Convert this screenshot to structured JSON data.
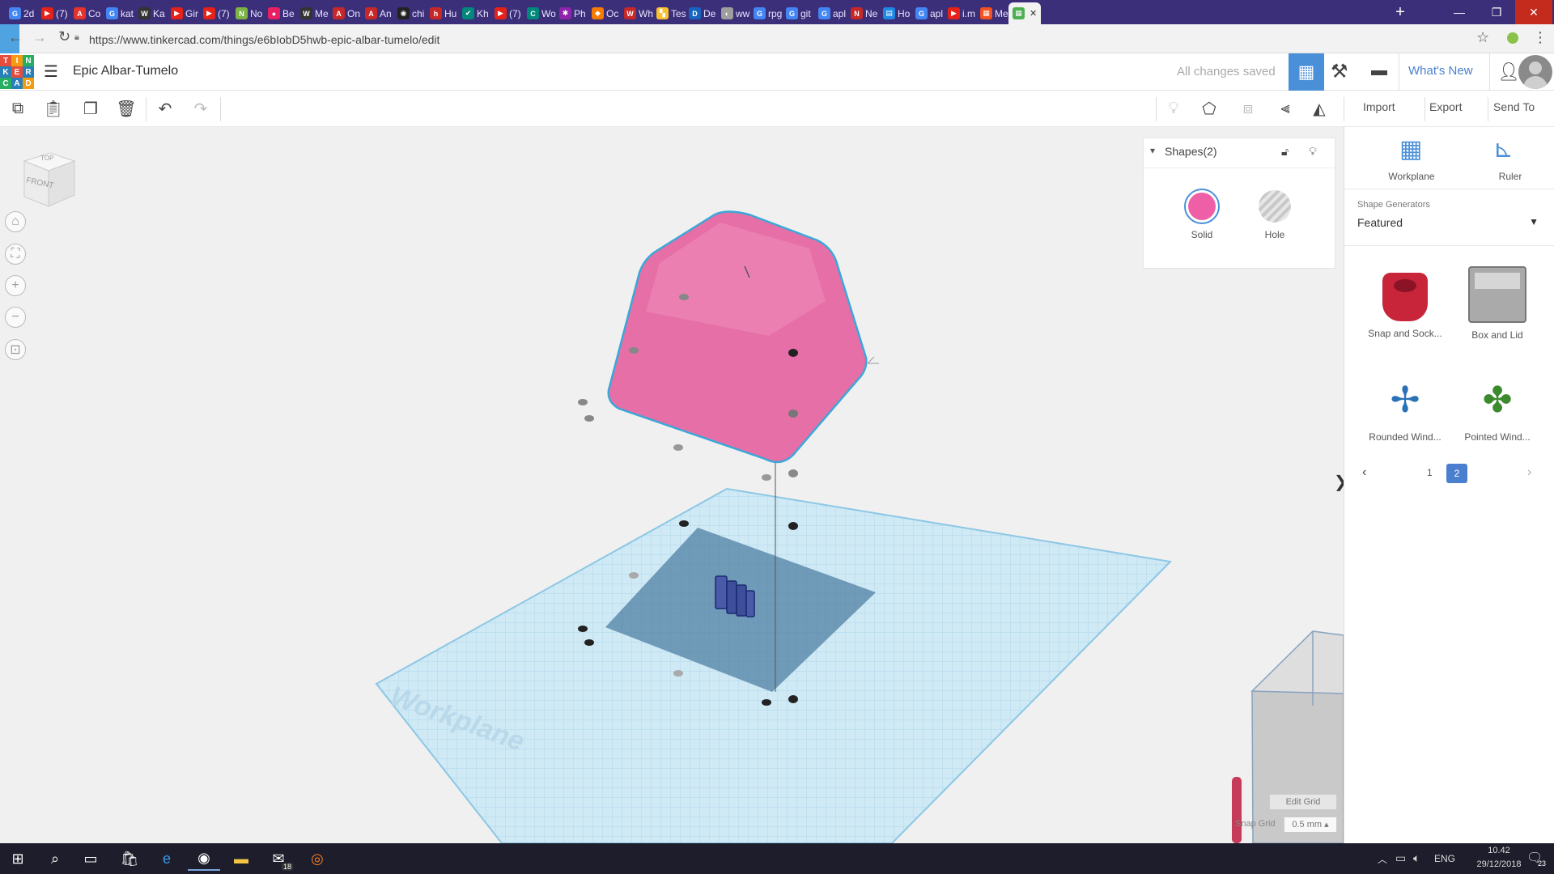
{
  "browser": {
    "tabs": [
      {
        "label": "2d",
        "color": "#4285f4",
        "glyph": "G"
      },
      {
        "label": "(7)",
        "color": "#e62117",
        "glyph": "▶"
      },
      {
        "label": "Co",
        "color": "#e5322d",
        "glyph": "A"
      },
      {
        "label": "kat",
        "color": "#4285f4",
        "glyph": "G"
      },
      {
        "label": "Ka",
        "color": "#333333",
        "glyph": "W"
      },
      {
        "label": "Gir",
        "color": "#e62117",
        "glyph": "▶"
      },
      {
        "label": "(7)",
        "color": "#e62117",
        "glyph": "▶"
      },
      {
        "label": "No",
        "color": "#7cb342",
        "glyph": "N"
      },
      {
        "label": "Be",
        "color": "#e91e63",
        "glyph": "●"
      },
      {
        "label": "Me",
        "color": "#333333",
        "glyph": "W"
      },
      {
        "label": "On",
        "color": "#c62828",
        "glyph": "A"
      },
      {
        "label": "An",
        "color": "#c62828",
        "glyph": "A"
      },
      {
        "label": "chi",
        "color": "#222222",
        "glyph": "◉"
      },
      {
        "label": "Hu",
        "color": "#c62828",
        "glyph": "h"
      },
      {
        "label": "Kh",
        "color": "#00897b",
        "glyph": "✔"
      },
      {
        "label": "(7)",
        "color": "#e62117",
        "glyph": "▶"
      },
      {
        "label": "Wo",
        "color": "#00897b",
        "glyph": "C"
      },
      {
        "label": "Ph",
        "color": "#8e24aa",
        "glyph": "✱"
      },
      {
        "label": "Oc",
        "color": "#f57c00",
        "glyph": "◆"
      },
      {
        "label": "Wh",
        "color": "#c62828",
        "glyph": "W"
      },
      {
        "label": "Tes",
        "color": "#fbc02d",
        "glyph": "▚"
      },
      {
        "label": "De",
        "color": "#1565c0",
        "glyph": "D"
      },
      {
        "label": "ww",
        "color": "#9e9e9e",
        "glyph": "◐"
      },
      {
        "label": "rpg",
        "color": "#4285f4",
        "glyph": "G"
      },
      {
        "label": "git",
        "color": "#4285f4",
        "glyph": "G"
      },
      {
        "label": "apl",
        "color": "#4285f4",
        "glyph": "G"
      },
      {
        "label": "Ne",
        "color": "#c62828",
        "glyph": "N"
      },
      {
        "label": "Ho",
        "color": "#1e88e5",
        "glyph": "▤"
      },
      {
        "label": "apl",
        "color": "#4285f4",
        "glyph": "G"
      },
      {
        "label": "i.m",
        "color": "#e62117",
        "glyph": "▶"
      },
      {
        "label": "Me",
        "color": "#f4511e",
        "glyph": "▦"
      },
      {
        "label": "",
        "color": "#4caf50",
        "glyph": "▦"
      }
    ],
    "url": "https://www.tinkercad.com/things/e6bIobD5hwb-epic-albar-tumelo/edit"
  },
  "app": {
    "logo_letters": [
      "T",
      "I",
      "N",
      "K",
      "E",
      "R",
      "C",
      "A",
      "D"
    ],
    "design_title": "Epic Albar-Tumelo",
    "save_status": "All changes saved",
    "whats_new": "What's New",
    "import_label": "Import",
    "export_label": "Export",
    "send_to_label": "Send To"
  },
  "viewcube": {
    "top": "TOP",
    "front": "FRONT"
  },
  "shapes_panel": {
    "title": "Shapes(2)",
    "solid_label": "Solid",
    "hole_label": "Hole",
    "solid_color": "#ef5fa7"
  },
  "right_panel": {
    "workplane_label": "Workplane",
    "ruler_label": "Ruler",
    "generators_label": "Shape Generators",
    "generators_value": "Featured",
    "shapes": [
      {
        "label": "Snap and Sock..."
      },
      {
        "label": "Box and Lid"
      },
      {
        "label": "Rounded Wind..."
      },
      {
        "label": "Pointed Wind..."
      }
    ],
    "pages": [
      "1",
      "2"
    ],
    "current_page": "2"
  },
  "workspace": {
    "workplane_label": "Workplane",
    "edit_grid": "Edit Grid",
    "snap_grid_label": "Snap Grid",
    "snap_grid_value": "0.5 mm ▴"
  },
  "taskbar": {
    "lang": "ENG",
    "time": "10.42",
    "date": "29/12/2018",
    "mail_badge": "18",
    "notif_badge": "23"
  }
}
